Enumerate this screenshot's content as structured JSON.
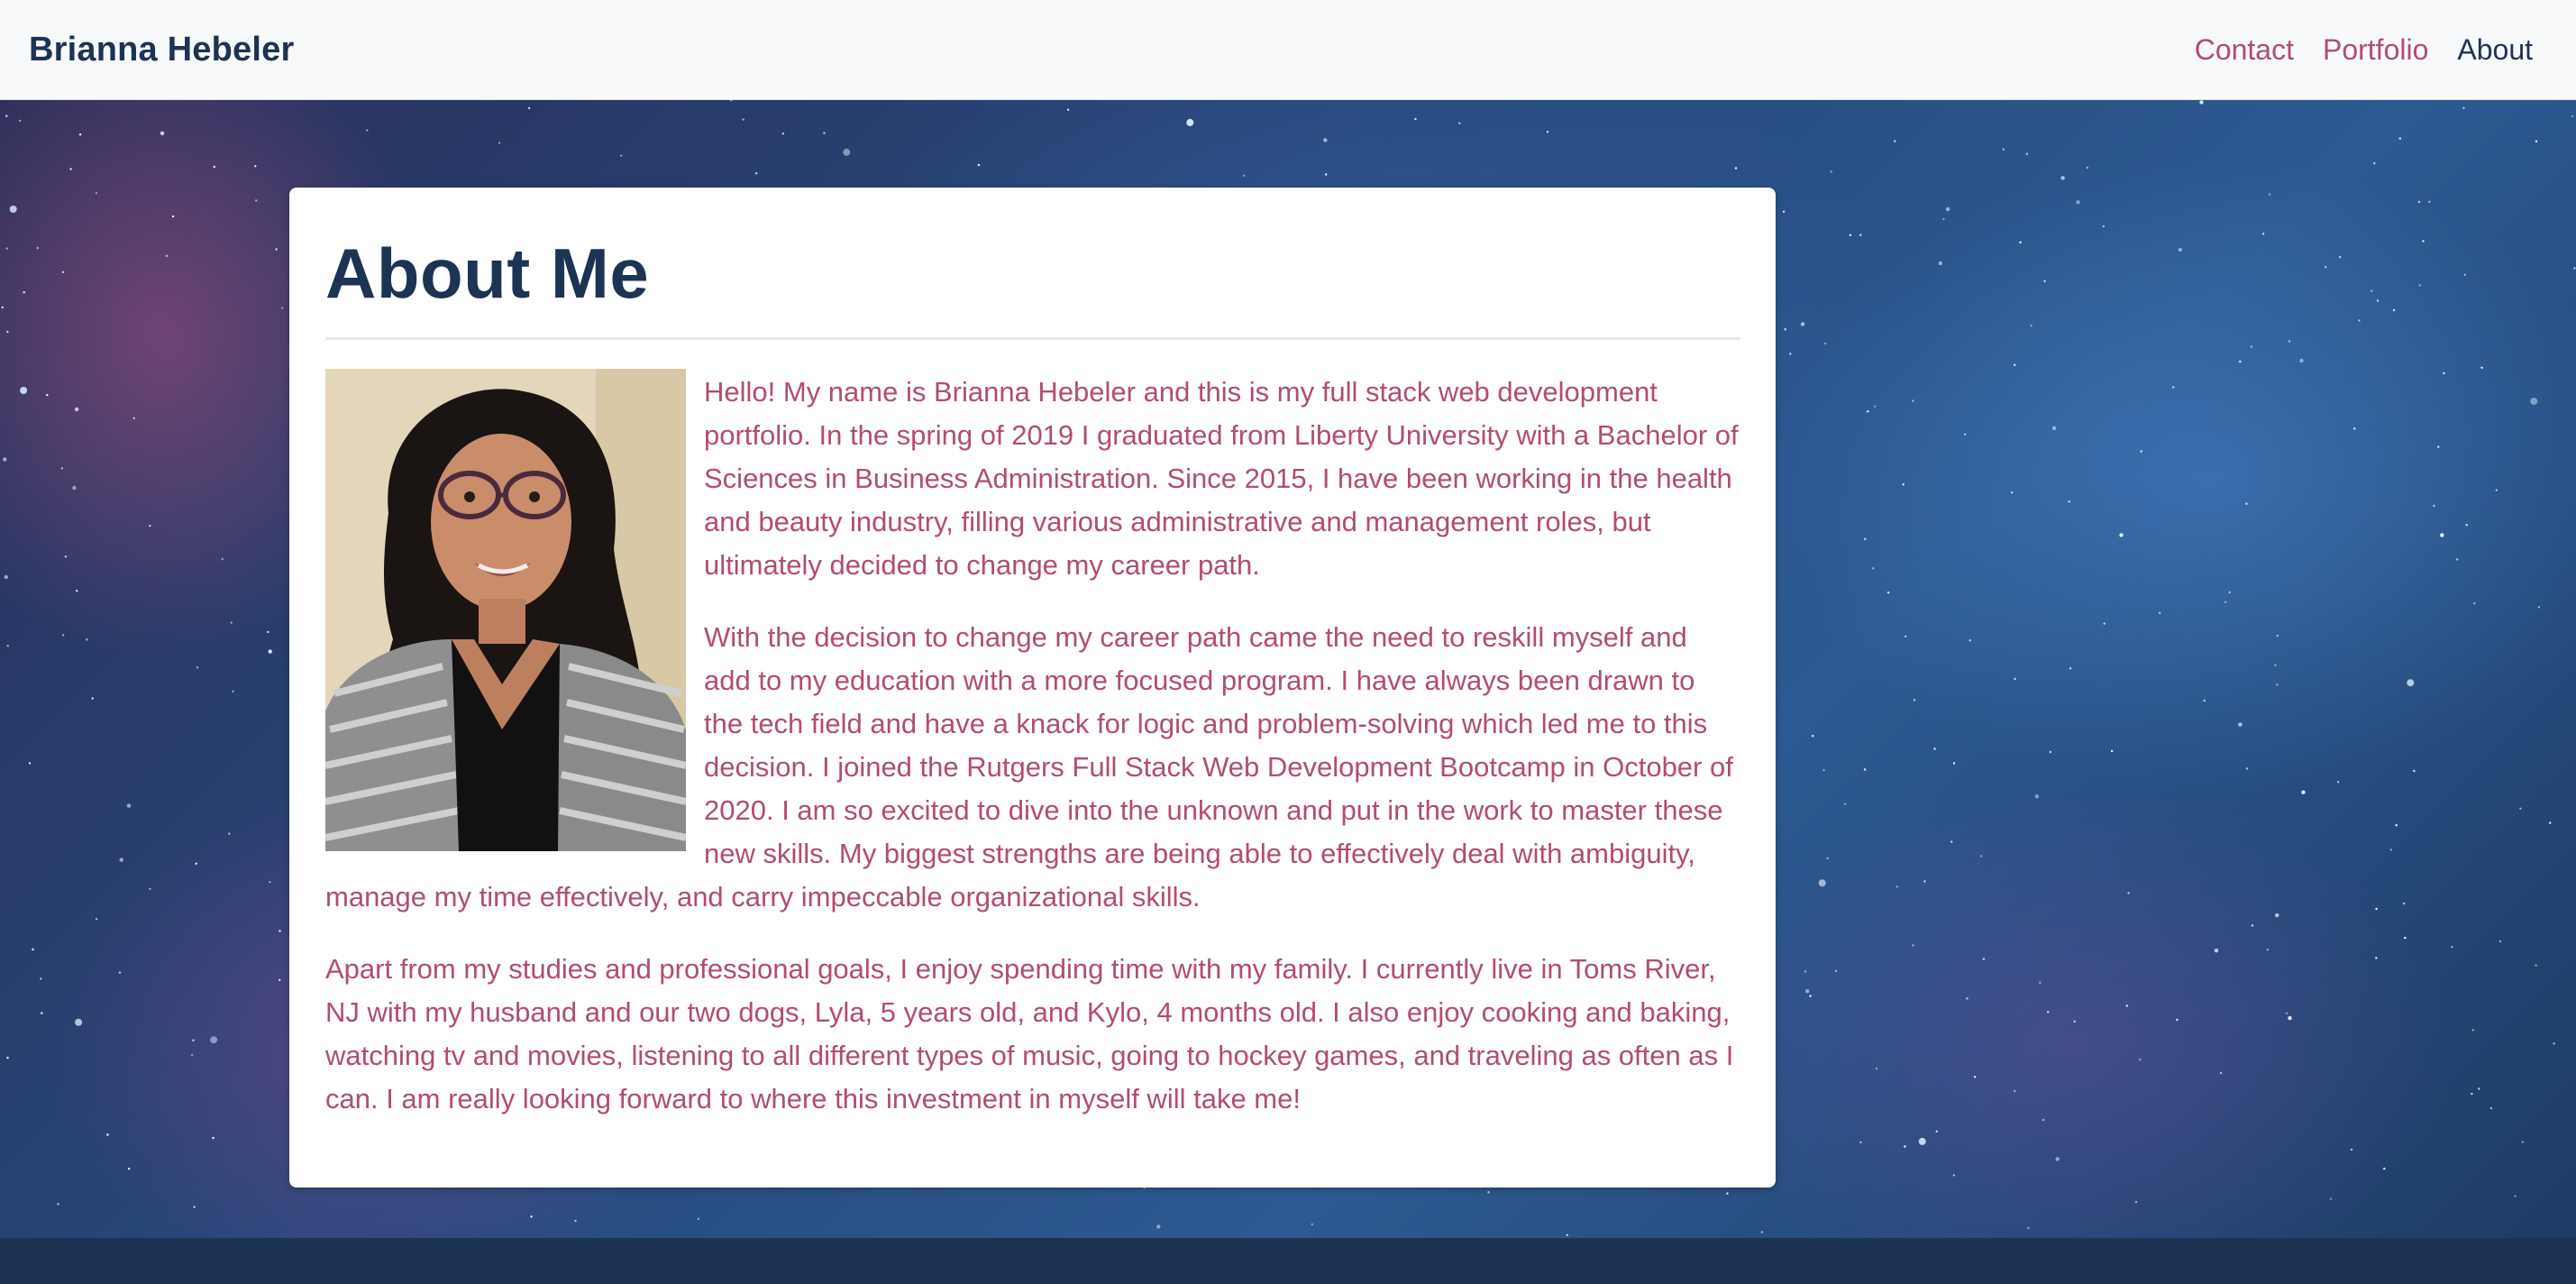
{
  "navbar": {
    "brand": "Brianna Hebeler",
    "links": [
      {
        "label": "Contact",
        "active": false
      },
      {
        "label": "Portfolio",
        "active": false
      },
      {
        "label": "About",
        "active": true
      }
    ]
  },
  "about": {
    "title": "About Me",
    "photo_icon": "profile-photo",
    "paragraphs": [
      "Hello! My name is Brianna Hebeler and this is my full stack web development portfolio. In the spring of 2019 I graduated from Liberty University with a Bachelor of Sciences in Business Administration. Since 2015, I have been working in the health and beauty industry, filling various administrative and management roles, but ultimately decided to change my career path.",
      "With the decision to change my career path came the need to reskill myself and add to my education with a more focused program. I have always been drawn to the tech field and have a knack for logic and problem-solving which led me to this decision. I joined the Rutgers Full Stack Web Development Bootcamp in October of 2020. I am so excited to dive into the unknown and put in the work to master these new skills. My biggest strengths are being able to effectively deal with ambiguity, manage my time effectively, and carry impeccable organizational skills.",
      "Apart from my studies and professional goals, I enjoy spending time with my family. I currently live in Toms River, NJ with my husband and our two dogs, Lyla, 5 years old, and Kylo, 4 months old. I also enjoy cooking and baking, watching tv and movies, listening to all different types of music, going to hockey games, and traveling as often as I can. I am really looking forward to where this investment in myself will take me!"
    ]
  },
  "colors": {
    "navy": "#1d3354",
    "accent": "#b24c73",
    "navbar_bg": "#f8f9fa"
  }
}
